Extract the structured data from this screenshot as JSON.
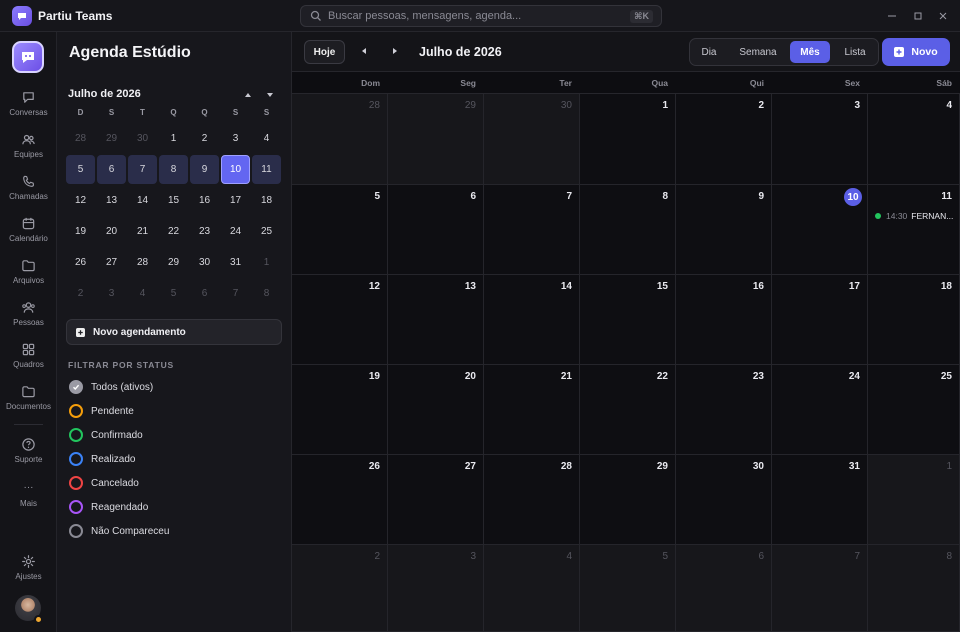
{
  "app": {
    "title": "Partiu Teams"
  },
  "search": {
    "placeholder": "Buscar pessoas, mensagens, agenda...",
    "shortcut": "⌘K"
  },
  "rail": {
    "items": [
      {
        "label": "Conversas",
        "icon": "chat-icon"
      },
      {
        "label": "Equipes",
        "icon": "team-icon"
      },
      {
        "label": "Chamadas",
        "icon": "phone-icon"
      },
      {
        "label": "Calendário",
        "icon": "calendar-icon"
      },
      {
        "label": "Arquivos",
        "icon": "folder-icon"
      },
      {
        "label": "Pessoas",
        "icon": "people-icon"
      },
      {
        "label": "Quadros",
        "icon": "grid-icon"
      },
      {
        "label": "Documentos",
        "icon": "document-icon"
      }
    ],
    "support": "Suporte",
    "more": "Mais",
    "more_glyph": "···",
    "settings": "Ajustes"
  },
  "sidebar": {
    "title": "Agenda Estúdio",
    "mini_calendar": {
      "month_label": "Julho de 2026",
      "weekday_heads": [
        "D",
        "S",
        "T",
        "Q",
        "Q",
        "S",
        "S"
      ],
      "weeks": [
        [
          "28",
          "29",
          "30",
          "1",
          "2",
          "3",
          "4"
        ],
        [
          "5",
          "6",
          "7",
          "8",
          "9",
          "10",
          "11"
        ],
        [
          "12",
          "13",
          "14",
          "15",
          "16",
          "17",
          "18"
        ],
        [
          "19",
          "20",
          "21",
          "22",
          "23",
          "24",
          "25"
        ],
        [
          "26",
          "27",
          "28",
          "29",
          "30",
          "31",
          "1"
        ],
        [
          "2",
          "3",
          "4",
          "5",
          "6",
          "7",
          "8"
        ]
      ],
      "selected_day": "10"
    },
    "new_appointment": "Novo agendamento",
    "filter_title": "FILTRAR POR STATUS",
    "filters": [
      {
        "label": "Todos (ativos)",
        "color": "#9a9aa4",
        "checked": true
      },
      {
        "label": "Pendente",
        "color": "#f59e0b"
      },
      {
        "label": "Confirmado",
        "color": "#22c55e"
      },
      {
        "label": "Realizado",
        "color": "#3b82f6"
      },
      {
        "label": "Cancelado",
        "color": "#ef4444"
      },
      {
        "label": "Reagendado",
        "color": "#a855f7"
      },
      {
        "label": "Não Compareceu",
        "color": "#8a8a94"
      }
    ]
  },
  "toolbar": {
    "today": "Hoje",
    "month_label": "Julho de 2026",
    "views": [
      "Dia",
      "Semana",
      "Mês",
      "Lista"
    ],
    "active_view": "Mês",
    "new": "Novo"
  },
  "calendar": {
    "weekdays": [
      "Dom",
      "Seg",
      "Ter",
      "Qua",
      "Qui",
      "Sex",
      "Sáb"
    ],
    "weeks": [
      [
        "28",
        "29",
        "30",
        "1",
        "2",
        "3",
        "4"
      ],
      [
        "5",
        "6",
        "7",
        "8",
        "9",
        "10",
        "11"
      ],
      [
        "12",
        "13",
        "14",
        "15",
        "16",
        "17",
        "18"
      ],
      [
        "19",
        "20",
        "21",
        "22",
        "23",
        "24",
        "25"
      ],
      [
        "26",
        "27",
        "28",
        "29",
        "30",
        "31",
        "1"
      ],
      [
        "2",
        "3",
        "4",
        "5",
        "6",
        "7",
        "8"
      ]
    ],
    "today": "10",
    "event": {
      "day": "11",
      "time": "14:30",
      "title": "FERNAN...",
      "status_color": "#22c55e"
    }
  },
  "colors": {
    "accent": "#5b5fe6",
    "background": "#0d0d11"
  }
}
